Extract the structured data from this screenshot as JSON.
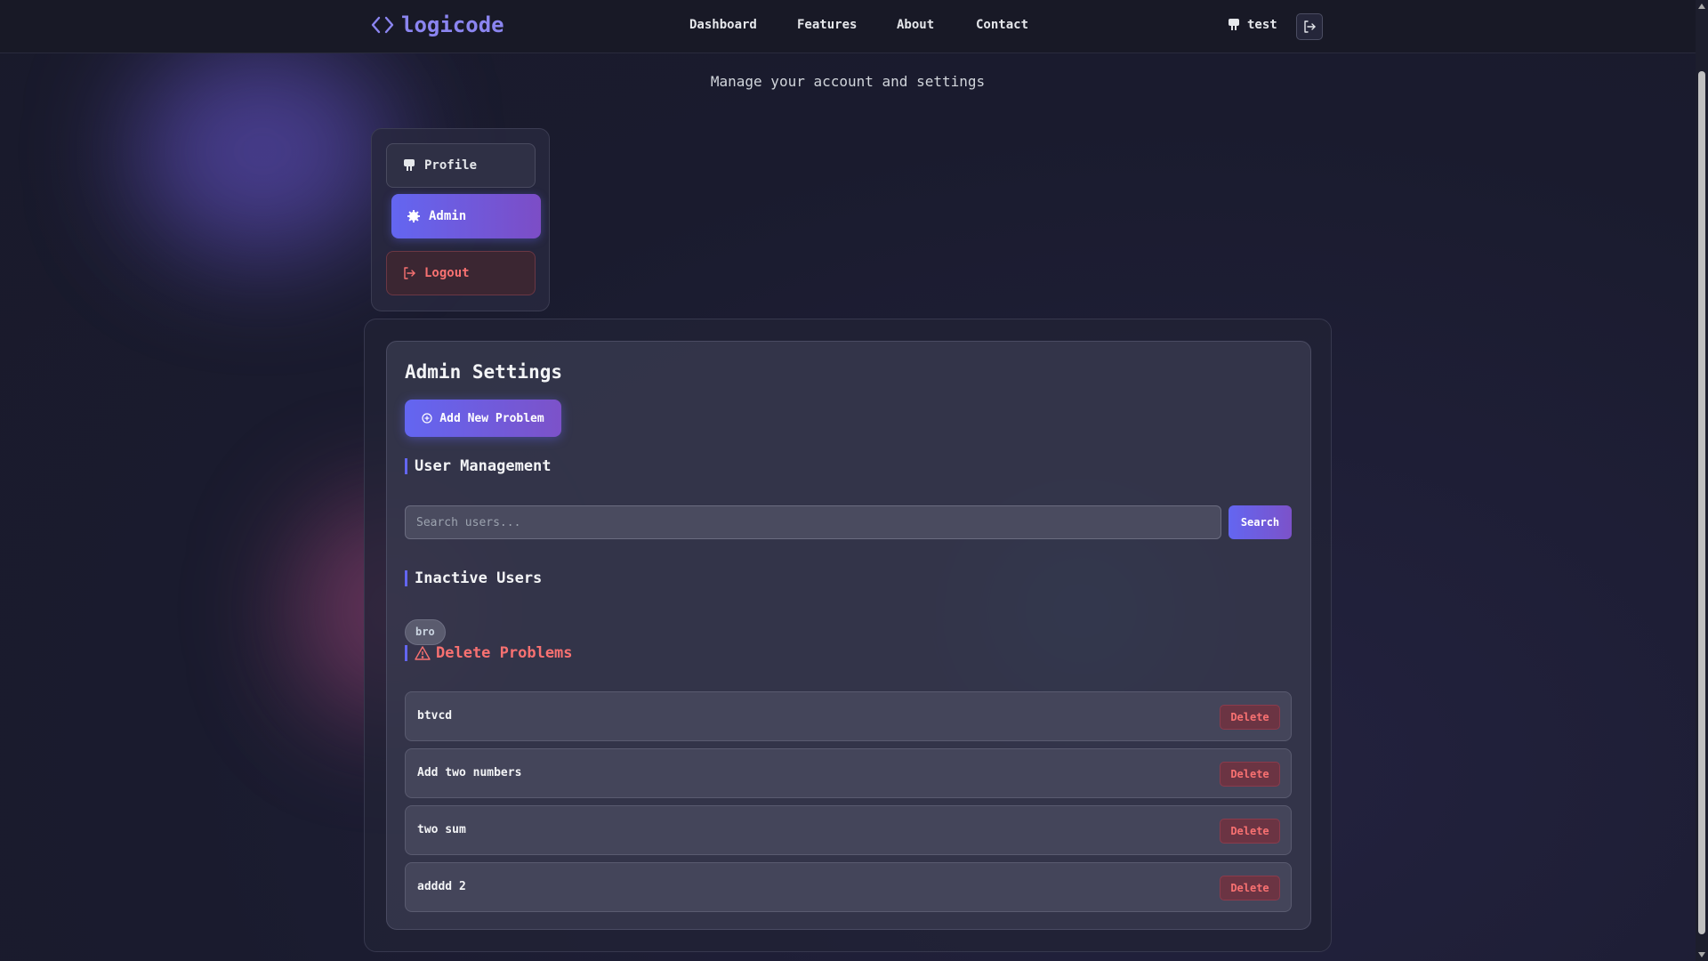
{
  "header": {
    "logo_text": "logicode",
    "nav": [
      "Dashboard",
      "Features",
      "About",
      "Contact"
    ],
    "username": "test",
    "icons": {
      "logo": "code-brackets-icon",
      "user": "user-icon",
      "logout": "logout-icon"
    }
  },
  "page": {
    "subtitle": "Manage your account and settings"
  },
  "sidebar": {
    "items": [
      {
        "label": "Profile",
        "icon": "user-icon"
      },
      {
        "label": "Admin",
        "icon": "gear-icon"
      },
      {
        "label": "Logout",
        "icon": "logout-icon"
      }
    ]
  },
  "admin": {
    "title": "Admin Settings",
    "add_problem_label": "Add New Problem",
    "user_management_title": "User Management",
    "search": {
      "placeholder": "Search users...",
      "button_label": "Search"
    },
    "inactive_users_title": "Inactive Users",
    "inactive_users": [
      "bro"
    ],
    "delete_problems_title": "Delete Problems",
    "problems": [
      {
        "name": "btvcd",
        "action": "Delete"
      },
      {
        "name": "Add two numbers",
        "action": "Delete"
      },
      {
        "name": "two sum",
        "action": "Delete"
      },
      {
        "name": "adddd 2",
        "action": "Delete"
      }
    ]
  },
  "colors": {
    "accent": "#6366f1",
    "danger": "#f87171",
    "background": "#1a1b2e"
  }
}
